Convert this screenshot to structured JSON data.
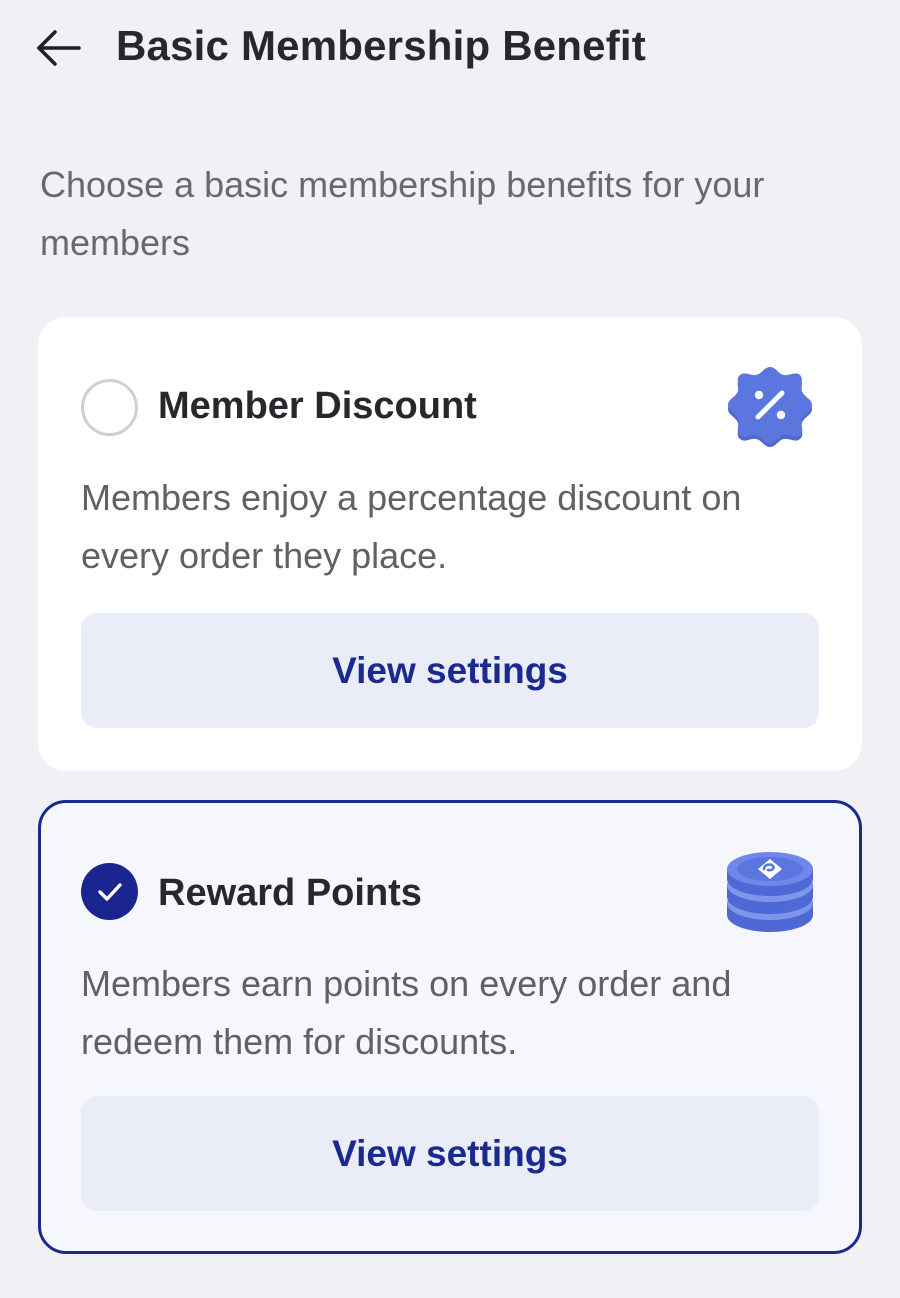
{
  "header": {
    "back_icon": "arrow-left-icon",
    "title": "Basic Membership Benefit"
  },
  "subtitle": "Choose a basic membership benefits for your members",
  "benefits": [
    {
      "title": "Member Discount",
      "description": "Members enjoy a percentage discount on every order they place.",
      "button_label": "View settings",
      "selected": false,
      "icon": "percent-badge-icon"
    },
    {
      "title": "Reward Points",
      "description": "Members earn points on every order and redeem them for discounts.",
      "button_label": "View settings",
      "selected": true,
      "icon": "coin-stack-icon"
    }
  ],
  "colors": {
    "accent": "#1a2590",
    "icon_blue": "#5b76e0",
    "button_bg": "#eaecf7",
    "page_bg": "#f1f1f5"
  }
}
